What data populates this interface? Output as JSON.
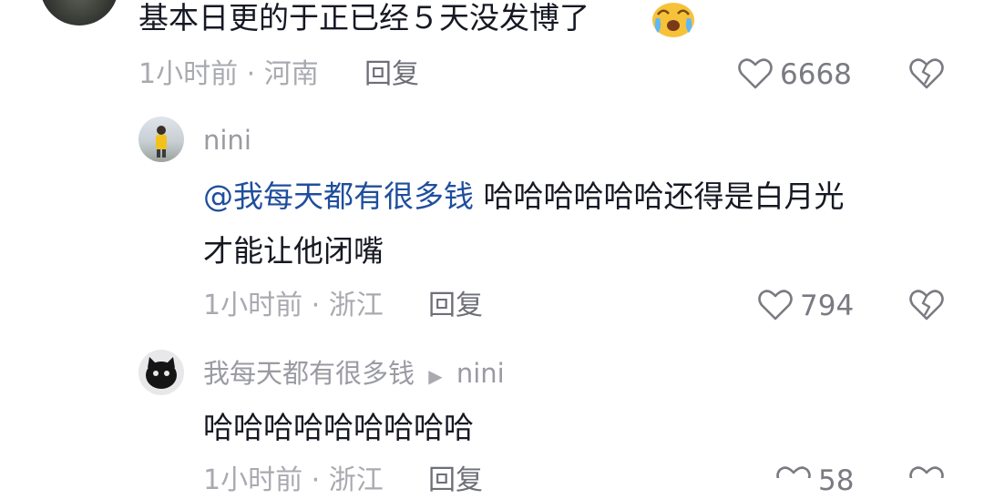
{
  "comment1": {
    "text": "基本日更的于正已经５天没发博了",
    "emoji": "crying-emoji",
    "meta": "1小时前 · 河南",
    "reply_label": "回复",
    "likes": "6668"
  },
  "reply1": {
    "username": "nini",
    "mention": "@我每天都有很多钱",
    "text_part1": "哈哈哈哈哈哈还得是白月光",
    "text_part2": "才能让他闭嘴",
    "meta": "1小时前 · 浙江",
    "reply_label": "回复",
    "likes": "794"
  },
  "reply2": {
    "username": "我每天都有很多钱",
    "reply_to": "nini",
    "text": "哈哈哈哈哈哈哈哈哈",
    "meta": "1小时前 · 浙江",
    "reply_label": "回复",
    "likes": "58"
  },
  "colors": {
    "mention": "#1f4e9e",
    "meta": "#a9aab0",
    "text": "#161823"
  }
}
